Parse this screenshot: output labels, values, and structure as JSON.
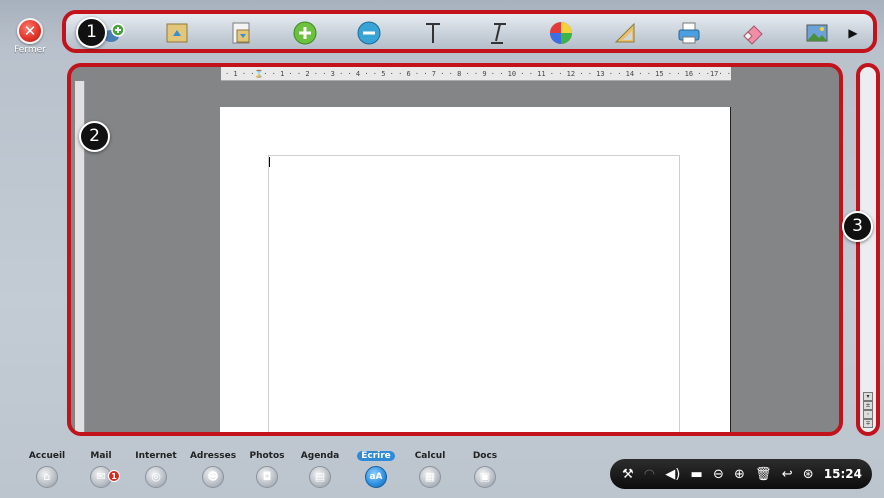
{
  "close": {
    "label": "Fermer"
  },
  "toolbar": {
    "items": [
      {
        "name": "new-document-icon"
      },
      {
        "name": "open-folder-icon"
      },
      {
        "name": "save-document-icon"
      },
      {
        "name": "zoom-in-icon"
      },
      {
        "name": "zoom-out-icon"
      },
      {
        "name": "text-font-icon"
      },
      {
        "name": "text-italic-icon"
      },
      {
        "name": "color-palette-icon"
      },
      {
        "name": "ruler-triangle-icon"
      },
      {
        "name": "printer-icon"
      },
      {
        "name": "eraser-icon"
      },
      {
        "name": "insert-image-icon"
      }
    ],
    "more_glyph": "▶"
  },
  "badges": {
    "toolbar": "1",
    "document": "2",
    "scrollbar": "3"
  },
  "ruler": {
    "text": "· 1 · ·⌛· · 1 · · 2 · · 3 · · 4 · · 5 · · 6 · · 7 · · 8 · · 9 · · 10 · · 11 · · 12 · · 13 · · 14 · · 15 · · 16 · ·17· · 18 · ·"
  },
  "dock": {
    "items": [
      {
        "label": "Accueil",
        "glyph": "⌂"
      },
      {
        "label": "Mail",
        "glyph": "✉"
      },
      {
        "label": "Internet",
        "glyph": "◎"
      },
      {
        "label": "Adresses",
        "glyph": "☻"
      },
      {
        "label": "Photos",
        "glyph": "◘"
      },
      {
        "label": "Agenda",
        "glyph": "▤"
      },
      {
        "label": "Ecrire",
        "glyph": "aA"
      },
      {
        "label": "Calcul",
        "glyph": "▦"
      },
      {
        "label": "Docs",
        "glyph": "▣"
      }
    ],
    "mail_badge": "1"
  },
  "tray": {
    "icons": [
      "⚒",
      "◠",
      "◀)",
      "▬",
      "⊖",
      "⊕",
      "🗑",
      "↩",
      "⊛"
    ],
    "clock": "15:24"
  },
  "colors": {
    "accent_red": "#c2131c",
    "active_blue": "#2f8ad8"
  }
}
